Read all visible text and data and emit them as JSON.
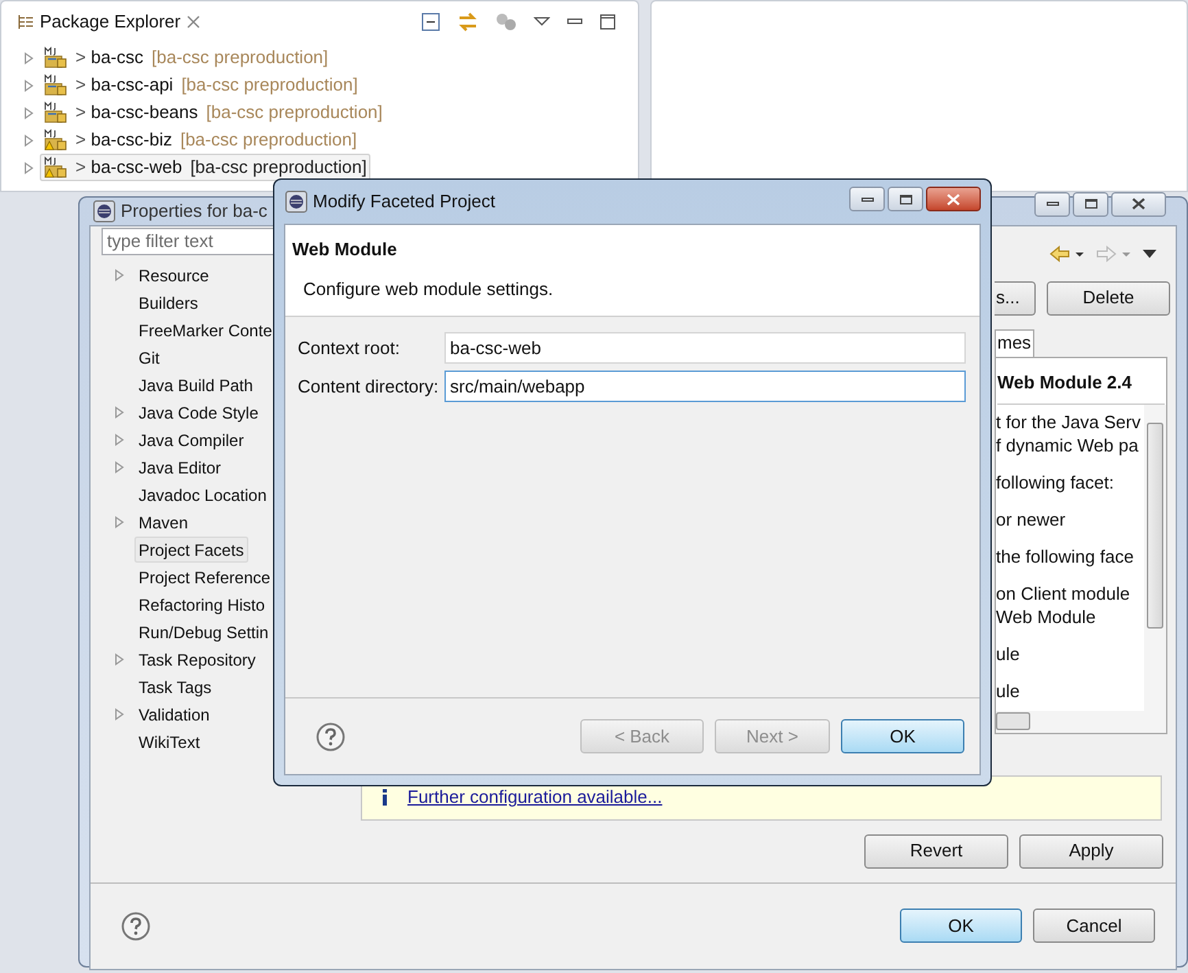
{
  "package_explorer": {
    "title": "Package Explorer",
    "rows": [
      {
        "marker": ">",
        "name": "ba-csc",
        "decoration": "[ba-csc preproduction]",
        "warning": false,
        "selected": false
      },
      {
        "marker": ">",
        "name": "ba-csc-api",
        "decoration": "[ba-csc preproduction]",
        "warning": false,
        "selected": false
      },
      {
        "marker": ">",
        "name": "ba-csc-beans",
        "decoration": "[ba-csc preproduction]",
        "warning": false,
        "selected": false
      },
      {
        "marker": ">",
        "name": "ba-csc-biz",
        "decoration": "[ba-csc preproduction]",
        "warning": true,
        "selected": false
      },
      {
        "marker": ">",
        "name": "ba-csc-web",
        "decoration": "[ba-csc preproduction]",
        "warning": true,
        "selected": true
      }
    ]
  },
  "properties": {
    "title": "Properties for ba-c",
    "filter_placeholder": "type filter text",
    "tree": [
      {
        "label": "Resource",
        "expandable": true,
        "selected": false
      },
      {
        "label": "Builders",
        "expandable": false,
        "selected": false
      },
      {
        "label": "FreeMarker Conte",
        "expandable": false,
        "selected": false
      },
      {
        "label": "Git",
        "expandable": false,
        "selected": false
      },
      {
        "label": "Java Build Path",
        "expandable": false,
        "selected": false
      },
      {
        "label": "Java Code Style",
        "expandable": true,
        "selected": false
      },
      {
        "label": "Java Compiler",
        "expandable": true,
        "selected": false
      },
      {
        "label": "Java Editor",
        "expandable": true,
        "selected": false
      },
      {
        "label": "Javadoc Location",
        "expandable": false,
        "selected": false
      },
      {
        "label": "Maven",
        "expandable": true,
        "selected": false
      },
      {
        "label": "Project Facets",
        "expandable": false,
        "selected": true
      },
      {
        "label": "Project Reference",
        "expandable": false,
        "selected": false
      },
      {
        "label": "Refactoring Histo",
        "expandable": false,
        "selected": false
      },
      {
        "label": "Run/Debug Settin",
        "expandable": false,
        "selected": false
      },
      {
        "label": "Task Repository",
        "expandable": true,
        "selected": false
      },
      {
        "label": "Task Tags",
        "expandable": false,
        "selected": false
      },
      {
        "label": "Validation",
        "expandable": true,
        "selected": false
      },
      {
        "label": "WikiText",
        "expandable": false,
        "selected": false
      }
    ],
    "top_buttons": [
      "s...",
      "Delete"
    ],
    "tab": "mes",
    "details": {
      "heading": "Web Module 2.4",
      "paragraphs": [
        [
          "t for the Java Serv",
          "f dynamic Web pa"
        ],
        [
          "following facet:"
        ],
        [
          "or newer"
        ],
        [
          "the following face"
        ],
        [
          "on Client module",
          "Web Module"
        ],
        [
          "ule"
        ],
        [
          "ule"
        ]
      ]
    },
    "info_link": "Further configuration available...",
    "page_buttons": [
      "Revert",
      "Apply"
    ],
    "dialog_buttons": [
      {
        "label": "OK",
        "default": true
      },
      {
        "label": "Cancel",
        "default": false
      }
    ]
  },
  "dialog": {
    "title": "Modify Faceted Project",
    "heading": "Web Module",
    "description": "Configure web module settings.",
    "fields": [
      {
        "label": "Context root:",
        "value": "ba-csc-web",
        "focused": false
      },
      {
        "label": "Content directory:",
        "value": "src/main/webapp",
        "focused": true
      }
    ],
    "buttons": [
      {
        "label": "< Back",
        "disabled": true,
        "default": false
      },
      {
        "label": "Next >",
        "disabled": true,
        "default": false
      },
      {
        "label": "OK",
        "disabled": false,
        "default": true
      }
    ]
  }
}
